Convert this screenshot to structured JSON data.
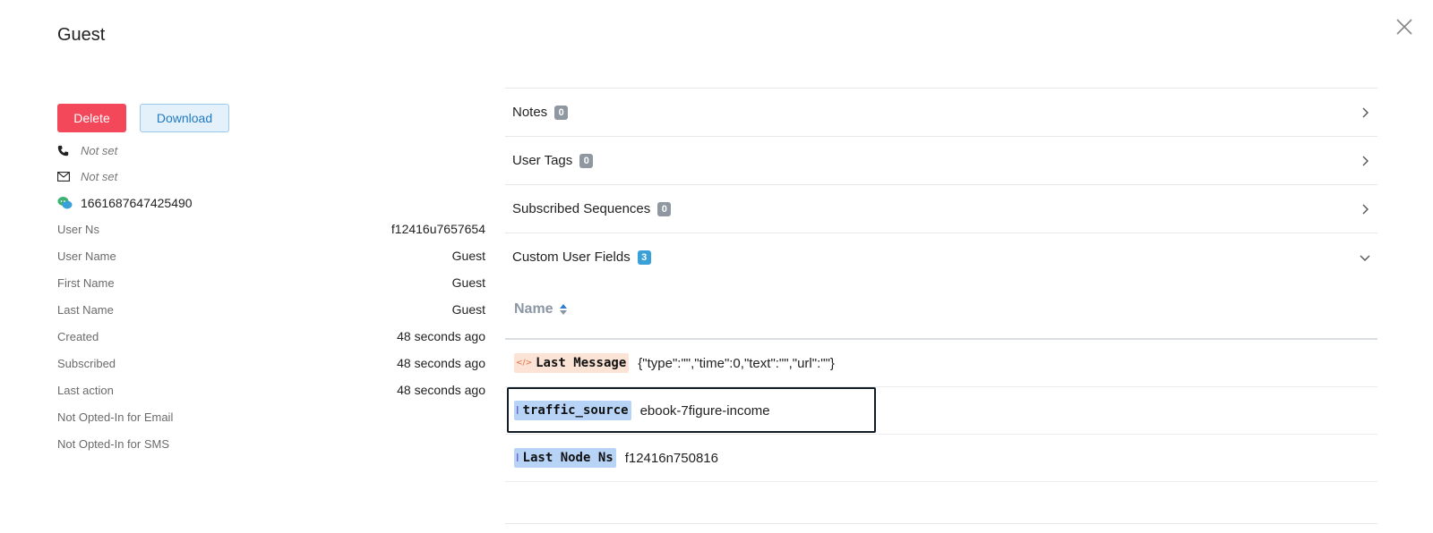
{
  "header": {
    "title": "Guest"
  },
  "actions": {
    "delete_label": "Delete",
    "download_label": "Download"
  },
  "contact": {
    "phone": "Not set",
    "email": "Not set",
    "messenger_id": "1661687647425490"
  },
  "details": [
    {
      "key": "User Ns",
      "value": "f12416u7657654"
    },
    {
      "key": "User Name",
      "value": "Guest"
    },
    {
      "key": "First Name",
      "value": "Guest"
    },
    {
      "key": "Last Name",
      "value": "Guest"
    },
    {
      "key": "Created",
      "value": "48 seconds ago"
    },
    {
      "key": "Subscribed",
      "value": "48 seconds ago"
    },
    {
      "key": "Last action",
      "value": "48 seconds ago"
    },
    {
      "key": "Not Opted-In for Email",
      "value": ""
    },
    {
      "key": "Not Opted-In for SMS",
      "value": ""
    }
  ],
  "sections": [
    {
      "label": "Notes",
      "count": "0",
      "expanded": false
    },
    {
      "label": "User Tags",
      "count": "0",
      "expanded": false
    },
    {
      "label": "Subscribed Sequences",
      "count": "0",
      "expanded": false
    },
    {
      "label": "Custom User Fields",
      "count": "3",
      "expanded": true
    }
  ],
  "custom_fields": {
    "column_header": "Name",
    "rows": [
      {
        "name": "Last Message",
        "type": "json",
        "icon": "code-icon",
        "value": "{\"type\":\"\",\"time\":0,\"text\":\"\",\"url\":\"\"}"
      },
      {
        "name": "traffic_source",
        "type": "text",
        "icon": "text-cursor-icon",
        "value": "ebook-7figure-income"
      },
      {
        "name": "Last Node Ns",
        "type": "text",
        "icon": "text-cursor-icon",
        "value": "f12416n750816"
      }
    ]
  },
  "colors": {
    "delete": "#f2485a",
    "download_bg": "#e4f1fb",
    "badge_grey": "#8f98a0",
    "badge_blue": "#3aa0d8",
    "json_tag": "#fbe3d6",
    "text_tag": "#b7d4f7"
  }
}
